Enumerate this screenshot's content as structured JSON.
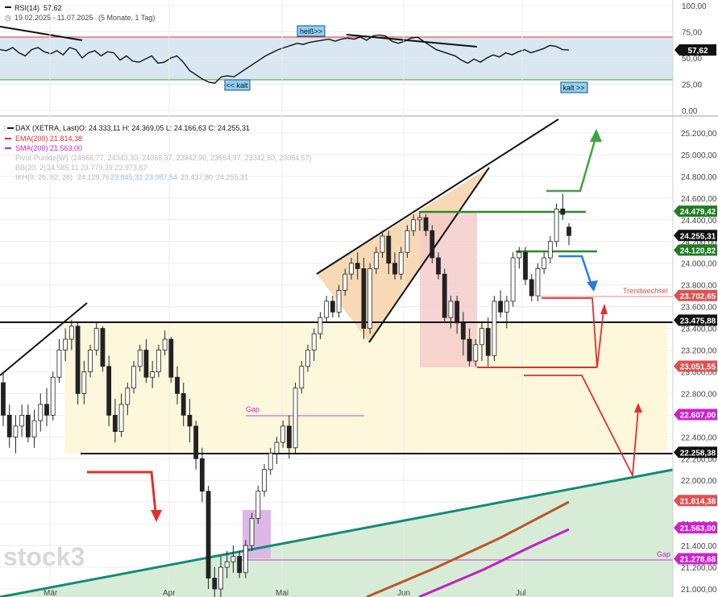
{
  "rsi_panel": {
    "title": "RSI(14)",
    "value_label": "57,62",
    "date_range": "19.02.2025 - 11.07.2025",
    "period_note": "(5 Monate, 1 Tag)",
    "hot_label": "heiß>>",
    "cold_label_left": "<< kalt",
    "cold_label_right": "kalt >>",
    "axis_ticks": [
      "100,00",
      "75,00",
      "50,00",
      "25,00",
      "0,00"
    ],
    "current_tag": "57,62",
    "level_hot": 75,
    "level_cold": 30
  },
  "main_panel": {
    "legend": {
      "instrument": "DAX (XETRA, Last)",
      "ohlc": "O: 24.333,11   H: 24.369,05   L: 24.166,63   C: 24.255,31",
      "ema": "EMA(200)",
      "ema_value": "21.814,38",
      "sma": "SMA(200)",
      "sma_value": "21.563,00",
      "pivot": "Pivot-Punkte(W)",
      "pivot_values": "(24666,77, 24343,30, 24065,37, 23842,90, 23564,97, 23342,50, 23064,57)",
      "bb": "BB(20, 2)",
      "bb_values": "24.585,11   23.779,39   22.973,67",
      "ikh": "IKH(9, 26, 52, 26)",
      "ikh_v1": "24.129,76",
      "ikh_v2": "23.845,32",
      "ikh_v3": "23.987,54",
      "ikh_v4": "23.437,80",
      "ikh_v5": "24.255,31"
    },
    "annotations": {
      "gap_upper": "Gap",
      "gap_lower": "Gap",
      "trendwechsel": "Trendwechsel"
    },
    "axis_ticks": [
      "25.200,00",
      "25.000,00",
      "24.800,00",
      "24.600,00",
      "24.400,00",
      "24.200,00",
      "24.000,00",
      "23.800,00",
      "23.600,00",
      "23.400,00",
      "23.200,00",
      "23.000,00",
      "22.800,00",
      "22.600,00",
      "22.400,00",
      "22.200,00",
      "22.000,00",
      "21.800,00",
      "21.600,00",
      "21.400,00",
      "21.200,00",
      "21.000,00"
    ],
    "x_labels": [
      "Mär",
      "Apr",
      "Mai",
      "Jun",
      "Jul"
    ],
    "price_tags": [
      {
        "label": "24.479,42",
        "color": "#1e7d1e"
      },
      {
        "label": "24.255,31",
        "color": "#111111"
      },
      {
        "label": "24.120,82",
        "color": "#1e7d1e"
      },
      {
        "label": "23.702,65",
        "color": "#e05050"
      },
      {
        "label": "23.475,88",
        "color": "#111111"
      },
      {
        "label": "23.051,55",
        "color": "#e05050"
      },
      {
        "label": "22.607,00",
        "color": "#d020d0"
      },
      {
        "label": "22.258,38",
        "color": "#111111"
      },
      {
        "label": "21.814,38",
        "color": "#e05050"
      },
      {
        "label": "21.563,00",
        "color": "#d020d0"
      },
      {
        "label": "21.278,68",
        "color": "#d020d0"
      }
    ]
  },
  "watermark": "stock3",
  "chart_data": {
    "type": "candlestick",
    "title": "DAX (XETRA, Last)",
    "period": "19.02.2025 - 11.07.2025",
    "ylim": [
      20900,
      25350
    ],
    "series": [
      {
        "name": "EMA(200)",
        "last": 21814.38
      },
      {
        "name": "SMA(200)",
        "last": 21563.0
      },
      {
        "name": "RSI(14)",
        "last": 57.62
      }
    ],
    "levels": [
      24479.42,
      24120.82,
      23702.65,
      23475.88,
      23051.55,
      22607.0,
      22258.38,
      21278.68
    ],
    "candles": [
      [
        22900,
        23000,
        22500,
        22600
      ],
      [
        22600,
        22700,
        22300,
        22400
      ],
      [
        22400,
        22600,
        22250,
        22500
      ],
      [
        22500,
        22700,
        22400,
        22600
      ],
      [
        22600,
        22700,
        22350,
        22400
      ],
      [
        22400,
        22650,
        22300,
        22550
      ],
      [
        22550,
        22800,
        22450,
        22700
      ],
      [
        22700,
        22850,
        22500,
        22600
      ],
      [
        22600,
        23000,
        22550,
        22950
      ],
      [
        22950,
        23300,
        22900,
        23200
      ],
      [
        23200,
        23400,
        23100,
        23300
      ],
      [
        23300,
        23480,
        23200,
        23420
      ],
      [
        23420,
        23450,
        22700,
        22800
      ],
      [
        22800,
        23100,
        22700,
        23000
      ],
      [
        23000,
        23250,
        22950,
        23200
      ],
      [
        23200,
        23450,
        23150,
        23400
      ],
      [
        23400,
        23420,
        23000,
        23050
      ],
      [
        23050,
        23150,
        22500,
        22600
      ],
      [
        22600,
        22750,
        22350,
        22450
      ],
      [
        22450,
        22800,
        22400,
        22700
      ],
      [
        22700,
        22900,
        22600,
        22850
      ],
      [
        22850,
        23100,
        22800,
        23050
      ],
      [
        23050,
        23250,
        23000,
        23200
      ],
      [
        23200,
        23300,
        22900,
        22950
      ],
      [
        22950,
        23100,
        22850,
        23000
      ],
      [
        23000,
        23250,
        22950,
        23200
      ],
      [
        23200,
        23380,
        23150,
        23300
      ],
      [
        23300,
        23320,
        22900,
        22950
      ],
      [
        22950,
        23050,
        22700,
        22800
      ],
      [
        22800,
        22900,
        22500,
        22600
      ],
      [
        22600,
        22750,
        22350,
        22500
      ],
      [
        22500,
        22550,
        22100,
        22200
      ],
      [
        22200,
        22300,
        21800,
        21900
      ],
      [
        21900,
        21950,
        21000,
        21100
      ],
      [
        21100,
        21200,
        20900,
        21000
      ],
      [
        21000,
        21300,
        20900,
        21200
      ],
      [
        21200,
        21350,
        21100,
        21250
      ],
      [
        21250,
        21400,
        21150,
        21300
      ],
      [
        21300,
        21350,
        21100,
        21150
      ],
      [
        21150,
        21450,
        21100,
        21400
      ],
      [
        21400,
        21700,
        21350,
        21650
      ],
      [
        21650,
        21950,
        21600,
        21900
      ],
      [
        21900,
        22150,
        21850,
        22100
      ],
      [
        22100,
        22300,
        22050,
        22250
      ],
      [
        22250,
        22400,
        22150,
        22350
      ],
      [
        22350,
        22550,
        22300,
        22500
      ],
      [
        22500,
        22600,
        22200,
        22300
      ],
      [
        22300,
        22900,
        22250,
        22850
      ],
      [
        22850,
        23100,
        22800,
        23050
      ],
      [
        23050,
        23250,
        23000,
        23200
      ],
      [
        23200,
        23400,
        23100,
        23350
      ],
      [
        23350,
        23550,
        23300,
        23500
      ],
      [
        23500,
        23700,
        23450,
        23650
      ],
      [
        23650,
        23700,
        23500,
        23550
      ],
      [
        23550,
        23800,
        23500,
        23750
      ],
      [
        23750,
        23950,
        23700,
        23900
      ],
      [
        23900,
        24050,
        23850,
        24000
      ],
      [
        24000,
        24100,
        23850,
        23950
      ],
      [
        23950,
        24050,
        23300,
        23400
      ],
      [
        23400,
        24000,
        23350,
        23950
      ],
      [
        23950,
        24150,
        23900,
        24100
      ],
      [
        24100,
        24300,
        24050,
        24250
      ],
      [
        24250,
        24300,
        23900,
        24000
      ],
      [
        24000,
        24100,
        23850,
        23900
      ],
      [
        23900,
        24150,
        23850,
        24100
      ],
      [
        24100,
        24350,
        24050,
        24300
      ],
      [
        24300,
        24450,
        24250,
        24400
      ],
      [
        24400,
        24480,
        24300,
        24420
      ],
      [
        24420,
        24450,
        24250,
        24300
      ],
      [
        24300,
        24350,
        24000,
        24050
      ],
      [
        24050,
        24100,
        23850,
        23900
      ],
      [
        23900,
        23950,
        23450,
        23500
      ],
      [
        23500,
        23700,
        23400,
        23650
      ],
      [
        23650,
        23700,
        23350,
        23450
      ],
      [
        23450,
        23550,
        23150,
        23300
      ],
      [
        23300,
        23400,
        23050,
        23100
      ],
      [
        23100,
        23300,
        23050,
        23250
      ],
      [
        23250,
        23450,
        23100,
        23400
      ],
      [
        23400,
        23500,
        23050,
        23150
      ],
      [
        23150,
        23700,
        23100,
        23650
      ],
      [
        23650,
        23750,
        23500,
        23550
      ],
      [
        23550,
        23700,
        23400,
        23650
      ],
      [
        23650,
        24100,
        23600,
        24050
      ],
      [
        24050,
        24150,
        23950,
        24100
      ],
      [
        24100,
        24150,
        23800,
        23850
      ],
      [
        23850,
        23900,
        23650,
        23700
      ],
      [
        23700,
        24000,
        23650,
        23950
      ],
      [
        23950,
        24100,
        23900,
        24050
      ],
      [
        24050,
        24250,
        24000,
        24200
      ],
      [
        24200,
        24550,
        24150,
        24500
      ],
      [
        24500,
        24640,
        24400,
        24450
      ],
      [
        24333,
        24369,
        24167,
        24255
      ]
    ]
  }
}
